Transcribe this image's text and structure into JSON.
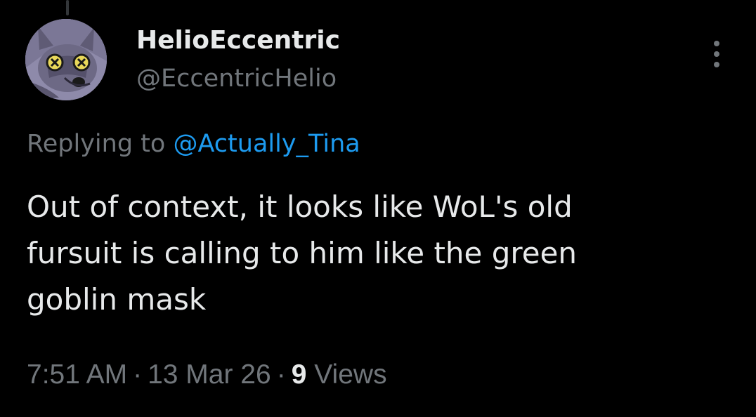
{
  "tweet": {
    "display_name": "HelioEccentric",
    "handle": "@EccentricHelio",
    "replying_prefix": "Replying to",
    "replying_to": "@Actually_Tina",
    "text_lines": [
      "Out of context, it looks like WoL's old",
      "fursuit is calling to him like the green",
      "goblin mask"
    ],
    "time": "7:51 AM",
    "date": "13 Mar 26",
    "separator": "·",
    "views_count": "9",
    "views_label": "Views"
  },
  "icons": {
    "avatar": "wolf-avatar-icon",
    "more": "more-options-icon"
  },
  "colors": {
    "background": "#000000",
    "primary_text": "#e7e9ea",
    "secondary_text": "#71767b",
    "link": "#1d9bf0"
  }
}
